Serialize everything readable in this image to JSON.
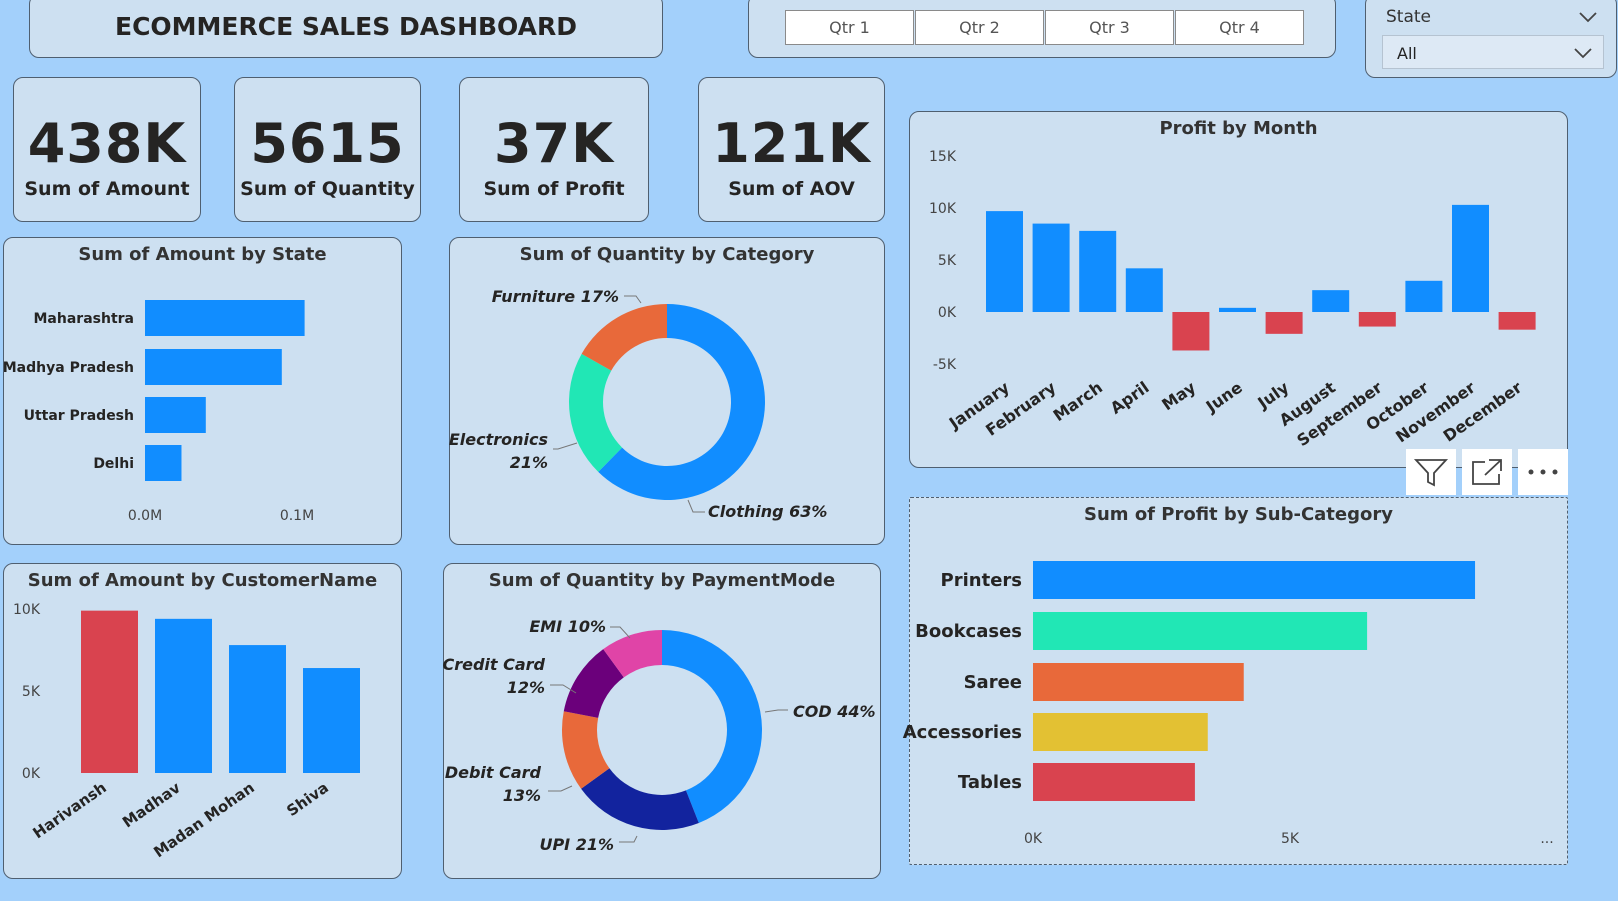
{
  "header": {
    "title": "ECOMMERCE SALES DASHBOARD"
  },
  "quarter_slicer": {
    "buttons": [
      "Qtr 1",
      "Qtr 2",
      "Qtr 3",
      "Qtr 4"
    ]
  },
  "state_slicer": {
    "label": "State",
    "selected": "All"
  },
  "kpis": [
    {
      "value": "438K",
      "label": "Sum of Amount"
    },
    {
      "value": "5615",
      "label": "Sum of Quantity"
    },
    {
      "value": "37K",
      "label": "Sum of Profit"
    },
    {
      "value": "121K",
      "label": "Sum of AOV"
    }
  ],
  "colors": {
    "blue": "#118dff",
    "red": "#d9434f",
    "background": "#a3d0fb",
    "card": "#cde0f1"
  },
  "chart_data": [
    {
      "id": "amount_by_state",
      "type": "bar",
      "orientation": "horizontal",
      "title": "Sum of Amount by State",
      "categories": [
        "Maharashtra",
        "Madhya Pradesh",
        "Uttar Pradesh",
        "Delhi"
      ],
      "values": [
        0.105,
        0.09,
        0.04,
        0.024
      ],
      "tick_labels": [
        "0.0M",
        "0.1M"
      ],
      "xlim": [
        0,
        0.1
      ]
    },
    {
      "id": "quantity_by_category",
      "type": "pie",
      "donut": true,
      "title": "Sum of Quantity by Category",
      "labels": [
        "Clothing",
        "Electronics",
        "Furniture"
      ],
      "values": [
        63,
        21,
        17
      ],
      "display_labels": [
        "Clothing 63%",
        "Electronics 21%",
        "Furniture 17%"
      ],
      "colors": [
        "#118dff",
        "#21e7b5",
        "#e8693a"
      ]
    },
    {
      "id": "profit_by_month",
      "type": "bar",
      "title": "Profit by Month",
      "categories": [
        "January",
        "February",
        "March",
        "April",
        "May",
        "June",
        "July",
        "August",
        "September",
        "October",
        "November",
        "December"
      ],
      "values": [
        9700,
        8500,
        7800,
        4200,
        -3700,
        400,
        -2100,
        2100,
        -1400,
        3000,
        10300,
        -1700
      ],
      "tick_labels": [
        "15K",
        "10K",
        "5K",
        "0K",
        "-5K"
      ],
      "ylim": [
        -5000,
        15000
      ],
      "positive_color": "#118dff",
      "negative_color": "#d9434f"
    },
    {
      "id": "amount_by_customer",
      "type": "bar",
      "title": "Sum of Amount by CustomerName",
      "categories": [
        "Harivansh",
        "Madhav",
        "Madan Mohan",
        "Shiva"
      ],
      "values": [
        9900,
        9400,
        7800,
        6400
      ],
      "tick_labels": [
        "10K",
        "5K",
        "0K"
      ],
      "ylim": [
        0,
        10000
      ],
      "colors": [
        "#d9434f",
        "#118dff",
        "#118dff",
        "#118dff"
      ]
    },
    {
      "id": "quantity_by_paymentmode",
      "type": "pie",
      "donut": true,
      "title": "Sum of Quantity by PaymentMode",
      "labels": [
        "COD",
        "UPI",
        "Debit Card",
        "Credit Card",
        "EMI"
      ],
      "values": [
        44,
        21,
        13,
        12,
        10
      ],
      "display_labels": [
        "COD 44%",
        "UPI 21%",
        "Debit Card 13%",
        "Credit Card 12%",
        "EMI 10%"
      ],
      "colors": [
        "#118dff",
        "#12239e",
        "#e8693a",
        "#6b007b",
        "#e044a7"
      ]
    },
    {
      "id": "profit_by_subcategory",
      "type": "bar",
      "orientation": "horizontal",
      "title": "Sum of Profit by Sub-Category",
      "categories": [
        "Printers",
        "Bookcases",
        "Saree",
        "Accessories",
        "Tables"
      ],
      "values": [
        8600,
        6500,
        4100,
        3400,
        3150
      ],
      "tick_labels": [
        "0K",
        "5K",
        "..."
      ],
      "xlim": [
        0,
        5000
      ],
      "colors": [
        "#118dff",
        "#21e7b5",
        "#e8693a",
        "#e3c133",
        "#d9434f"
      ]
    }
  ]
}
